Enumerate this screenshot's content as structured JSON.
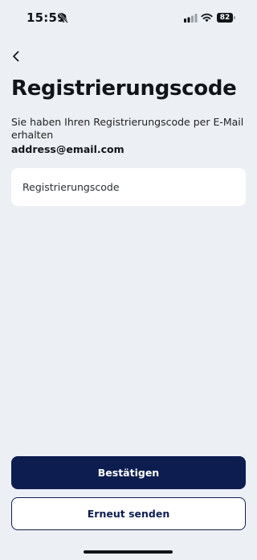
{
  "status_bar": {
    "time": "15:59",
    "battery": "82"
  },
  "page": {
    "title": "Registrierungscode",
    "description": "Sie haben Ihren Registrierungscode per E-Mail erhalten",
    "email": "address@email.com"
  },
  "form": {
    "code_placeholder": "Registrierungscode",
    "code_value": ""
  },
  "actions": {
    "confirm_label": "Bestätigen",
    "resend_label": "Erneut senden"
  },
  "icons": {
    "back": "chevron-left-icon",
    "silent": "bell-slash-icon",
    "signal": "cellular-signal-icon",
    "wifi": "wifi-icon",
    "battery": "battery-icon"
  },
  "colors": {
    "background": "#ecf0f5",
    "primary": "#0d1d4f",
    "field_background": "#ffffff",
    "text": "#111418"
  }
}
